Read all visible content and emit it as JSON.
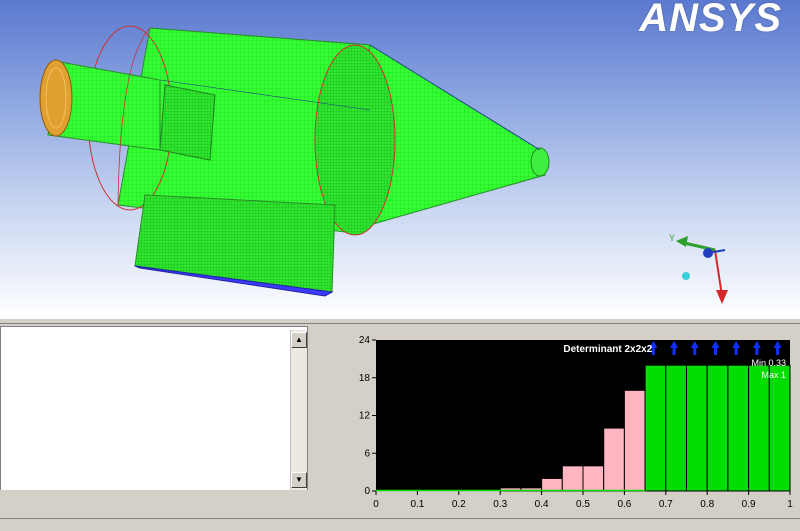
{
  "brand": {
    "text": "ANSYS"
  },
  "axis_triad": {
    "y_label": "Y",
    "colors": {
      "y": "#2ca02c",
      "x": "#d62728",
      "z": "#1f3fbf"
    }
  },
  "colors": {
    "mesh_green": "#33ff33",
    "mesh_line": "#6fe06f",
    "inlet_face": "#e0a030",
    "outlet_face": "#3b3bff",
    "plot_background": "#000000",
    "bar_low": "#ffb6c1",
    "bar_high": "#00dd00",
    "arrow": "#1030ff"
  },
  "log_panel": {
    "text": ""
  },
  "chart_data": {
    "type": "bar",
    "title": "Determinant 2x2x2",
    "annotations": [
      "Min 0.33",
      "Max 1"
    ],
    "x_ticks": [
      "0",
      "0.1",
      "0.2",
      "0.3",
      "0.4",
      "0.5",
      "0.6",
      "0.7",
      "0.8",
      "0.9",
      "1"
    ],
    "y_ticks": [
      "0",
      "6",
      "12",
      "18",
      "24"
    ],
    "xlim": [
      0,
      1
    ],
    "ylim": [
      0,
      24
    ],
    "bins": [
      {
        "x0": 0.0,
        "x1": 0.3,
        "value": 0,
        "highlight": false
      },
      {
        "x0": 0.3,
        "x1": 0.35,
        "value": 0.5,
        "highlight": false
      },
      {
        "x0": 0.35,
        "x1": 0.4,
        "value": 0.5,
        "highlight": false
      },
      {
        "x0": 0.4,
        "x1": 0.45,
        "value": 2,
        "highlight": false
      },
      {
        "x0": 0.45,
        "x1": 0.5,
        "value": 4,
        "highlight": false
      },
      {
        "x0": 0.5,
        "x1": 0.55,
        "value": 4,
        "highlight": false
      },
      {
        "x0": 0.55,
        "x1": 0.6,
        "value": 10,
        "highlight": false
      },
      {
        "x0": 0.6,
        "x1": 0.65,
        "value": 16,
        "highlight": false
      },
      {
        "x0": 0.65,
        "x1": 0.7,
        "value": 20,
        "highlight": true
      },
      {
        "x0": 0.7,
        "x1": 0.75,
        "value": 20,
        "highlight": true
      },
      {
        "x0": 0.75,
        "x1": 0.8,
        "value": 20,
        "highlight": true
      },
      {
        "x0": 0.8,
        "x1": 0.85,
        "value": 20,
        "highlight": true
      },
      {
        "x0": 0.85,
        "x1": 0.9,
        "value": 20,
        "highlight": true
      },
      {
        "x0": 0.9,
        "x1": 0.95,
        "value": 20,
        "highlight": true
      },
      {
        "x0": 0.95,
        "x1": 1.0,
        "value": 20,
        "highlight": true
      }
    ],
    "overflow_arrows_at": [
      0.67,
      0.72,
      0.77,
      0.82,
      0.87,
      0.92,
      0.97
    ]
  }
}
